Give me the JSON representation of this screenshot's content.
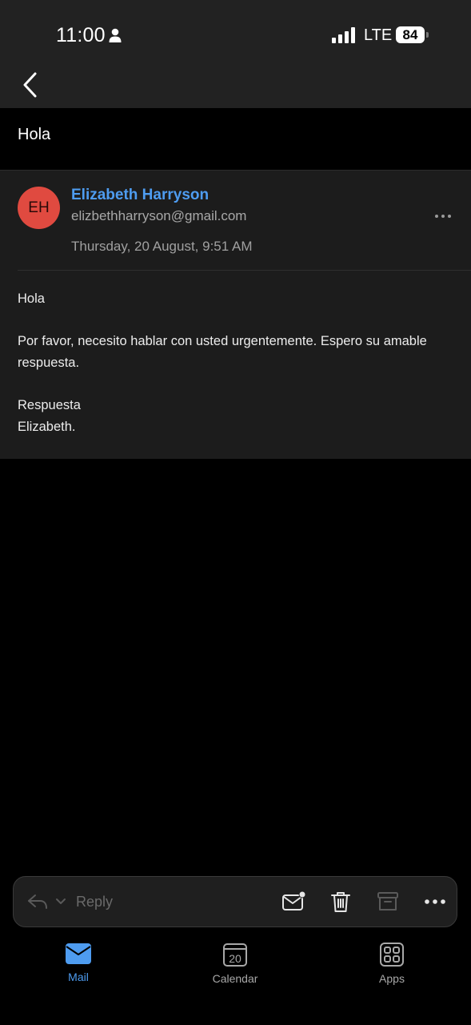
{
  "status_bar": {
    "time": "11:00",
    "network": "LTE",
    "battery": "84"
  },
  "message": {
    "subject": "Hola",
    "sender": {
      "initials": "EH",
      "name": "Elizabeth Harryson",
      "email": "elizbethharryson@gmail.com",
      "avatar_color": "#e04a40"
    },
    "date": "Thursday, 20 August, 9:51 AM",
    "body": {
      "greeting": "Hola",
      "paragraph": "Por favor, necesito hablar con usted urgentemente. Espero su amable respuesta.",
      "closing": "Respuesta",
      "signature": "Elizabeth."
    }
  },
  "toolbar": {
    "reply_label": "Reply",
    "icons": [
      "reply-icon",
      "chevron-down-icon",
      "mark-unread-icon",
      "trash-icon",
      "archive-icon",
      "more-icon"
    ]
  },
  "tabs": [
    {
      "label": "Mail",
      "icon": "mail-icon",
      "active": true
    },
    {
      "label": "Calendar",
      "icon": "calendar-icon",
      "day": "20",
      "active": false
    },
    {
      "label": "Apps",
      "icon": "apps-icon",
      "active": false
    }
  ],
  "colors": {
    "accent": "#4e9cf0",
    "background": "#000000",
    "card": "#1c1c1c",
    "topbar": "#222222"
  }
}
